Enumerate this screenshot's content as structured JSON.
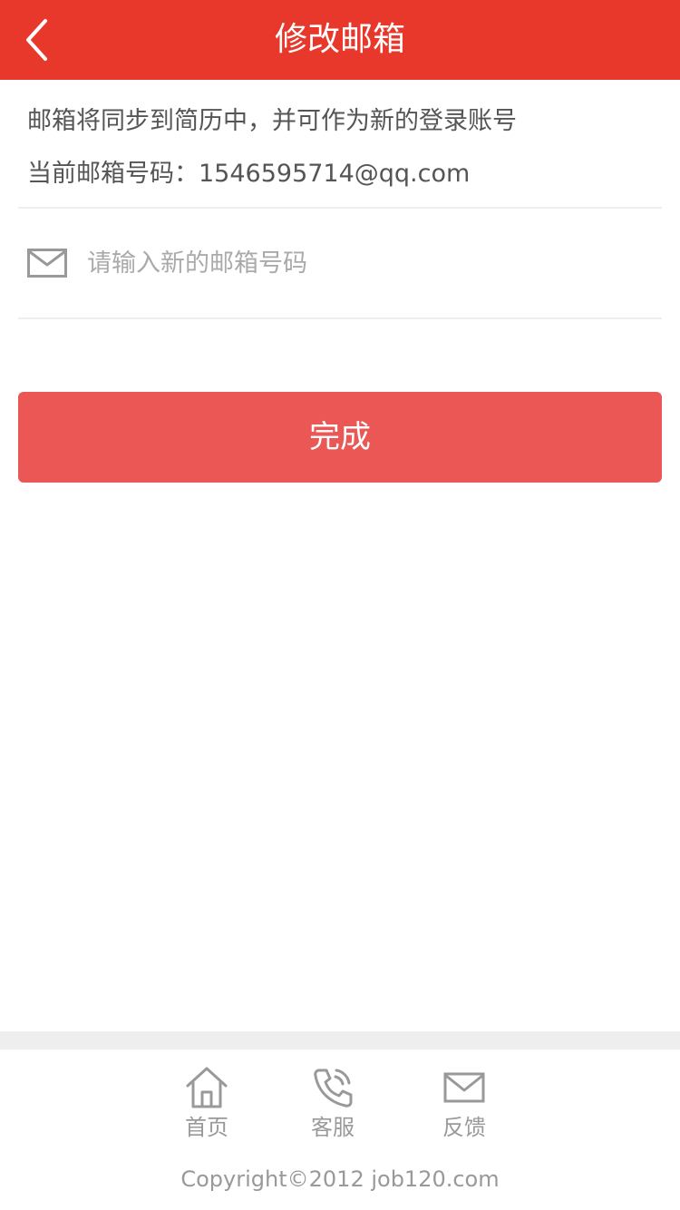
{
  "header": {
    "title": "修改邮箱",
    "back_icon": "chevron-left-icon",
    "background": "#e8382b"
  },
  "info": {
    "sync_notice": "邮箱将同步到简历中，并可作为新的登录账号",
    "current_email_label": "当前邮箱号码：",
    "current_email_value": "1546595714@qq.com"
  },
  "email_field": {
    "icon": "mail-icon",
    "placeholder": "请输入新的邮箱号码",
    "value": ""
  },
  "done_button": {
    "label": "完成",
    "color": "#ea5755"
  },
  "footer": {
    "nav": [
      {
        "label": "首页",
        "icon": "home-icon"
      },
      {
        "label": "客服",
        "icon": "phone-icon"
      },
      {
        "label": "反馈",
        "icon": "mail-icon"
      }
    ],
    "copyright": "Copyright©2012  job120.com"
  }
}
